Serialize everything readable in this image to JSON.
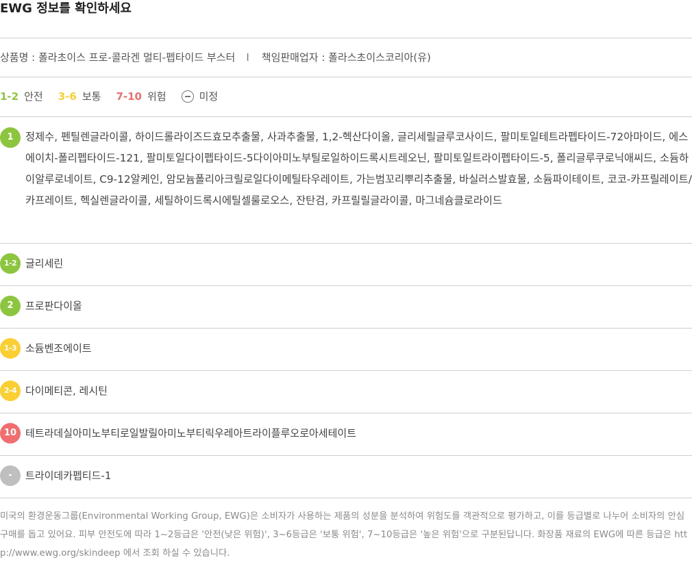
{
  "header": {
    "title": "EWG 정보를 확인하세요"
  },
  "product": {
    "name_label": "상품명 : 폴라초이스 프로-콜라겐 멀티-펩타이드 부스터",
    "separator": "I",
    "seller_label": "책임판매업자 : 폴라스초이스코리아(유)"
  },
  "legend": {
    "safe_range": "1-2",
    "safe_label": "안전",
    "normal_range": "3-6",
    "normal_label": "보통",
    "danger_range": "7-10",
    "danger_label": "위험",
    "undetermined_label": "미정",
    "undetermined_icon": "minus-circle-icon"
  },
  "colors": {
    "safe": "#8cc63f",
    "normal": "#fbcf31",
    "danger": "#f26d6d",
    "undetermined": "#bfbfbf"
  },
  "ingredients": [
    {
      "grade": "1",
      "level": "safe",
      "text": "정제수, 펜틸렌글라이콜, 하이드롤라이즈드효모추출물, 사과추출물, 1,2-헥산다이올, 글리세릴글루코사이드, 팔미토일테트라펩타이드-72아마이드, 에스에이치-폴리펩타이드-121, 팔미토일다이펩타이드-5다이아미노부틸로일하이드록시트레오닌, 팔미토일트라이펩타이드-5, 폴리글루쿠로닉애씨드, 소듐하이알루로네이트, C9-12알케인, 암모늄폴리아크릴로일다이메틸타우레이트, 가는범꼬리뿌리추출물, 바실러스발효물, 소듐파이테이트, 코코-카프릴레이트/카프레이트, 헥실렌글라이콜, 세틸하이드록시에틸셀룰로오스, 잔탄검, 카프릴릴글라이콜, 마그네슘클로라이드"
    },
    {
      "grade": "1-2",
      "level": "safe",
      "text": "글리세린"
    },
    {
      "grade": "2",
      "level": "safe",
      "text": "프로판다이올"
    },
    {
      "grade": "1-3",
      "level": "normal",
      "text": "소듐벤조에이트"
    },
    {
      "grade": "2-4",
      "level": "normal",
      "text": "다이메티콘, 레시틴"
    },
    {
      "grade": "10",
      "level": "danger",
      "text": "테트라데실아미노부티로일발릴아미노부티릭우레아트라이플루오로아세테이트"
    },
    {
      "grade": "-",
      "level": "undetermined",
      "text": "트라이데카펩티드-1"
    }
  ],
  "disclaimer": "미국의 환경운동그룹(Environmental Working Group, EWG)은 소비자가 사용하는 제품의 성분을 분석하여 위험도를 객관적으로 평가하고, 이를 등급별로 나누어 소비자의 안심 구매를 돕고 있어요. 피부 안전도에 따라 1~2등급은 '안전(낮은 위험)', 3~6등급은 '보통 위험', 7~10등급은 '높은 위험'으로 구분된답니다. 화장품 재료의 EWG에 따른 등급은 http://www.ewg.org/skindeep 에서 조회 하실 수 있습니다."
}
